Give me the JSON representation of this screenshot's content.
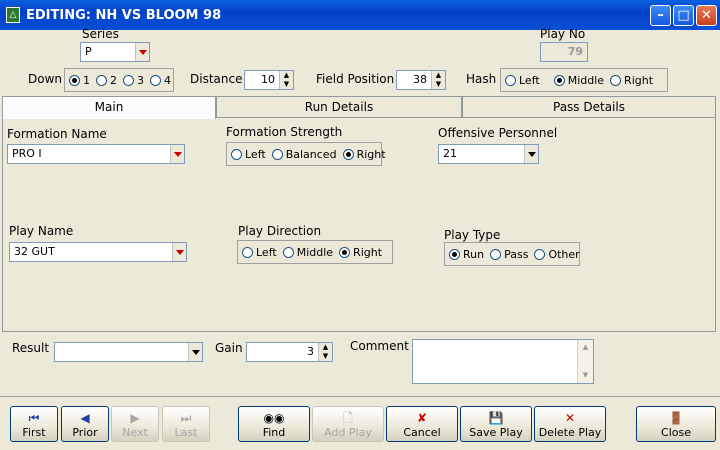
{
  "window": {
    "title": "EDITING: NH VS BLOOM 98"
  },
  "series": {
    "label": "Series",
    "value": "P"
  },
  "play_no": {
    "label": "Play No",
    "value": "79"
  },
  "down": {
    "label": "Down",
    "options": [
      "1",
      "2",
      "3",
      "4"
    ],
    "selected": "1"
  },
  "distance": {
    "label": "Distance",
    "value": "10"
  },
  "field_position": {
    "label": "Field Position",
    "value": "38"
  },
  "hash": {
    "label": "Hash",
    "options": [
      "Left",
      "Middle",
      "Right"
    ],
    "selected": "Middle"
  },
  "tabs": [
    {
      "label": "Main",
      "active": true
    },
    {
      "label": "Run Details",
      "active": false
    },
    {
      "label": "Pass Details",
      "active": false
    }
  ],
  "formation_name": {
    "label": "Formation Name",
    "value": "PRO I"
  },
  "formation_strength": {
    "label": "Formation Strength",
    "options": [
      "Left",
      "Balanced",
      "Right"
    ],
    "selected": "Right"
  },
  "offensive_personnel": {
    "label": "Offensive Personnel",
    "value": "21"
  },
  "play_name": {
    "label": "Play Name",
    "value": "32 GUT"
  },
  "play_direction": {
    "label": "Play Direction",
    "options": [
      "Left",
      "Middle",
      "Right"
    ],
    "selected": "Right"
  },
  "play_type": {
    "label": "Play Type",
    "options": [
      "Run",
      "Pass",
      "Other"
    ],
    "selected": "Run"
  },
  "result": {
    "label": "Result",
    "value": ""
  },
  "gain": {
    "label": "Gain",
    "value": "3"
  },
  "comment": {
    "label": "Comment",
    "value": ""
  },
  "buttons": {
    "first": "First",
    "prior": "Prior",
    "next": "Next",
    "last": "Last",
    "find": "Find",
    "add_play": "Add Play",
    "cancel": "Cancel",
    "save_play": "Save Play",
    "delete_play": "Delete Play",
    "close": "Close"
  },
  "colors": {
    "title_bar": "#0342c8",
    "accent_red": "#cc0000",
    "face": "#ece9d8"
  }
}
